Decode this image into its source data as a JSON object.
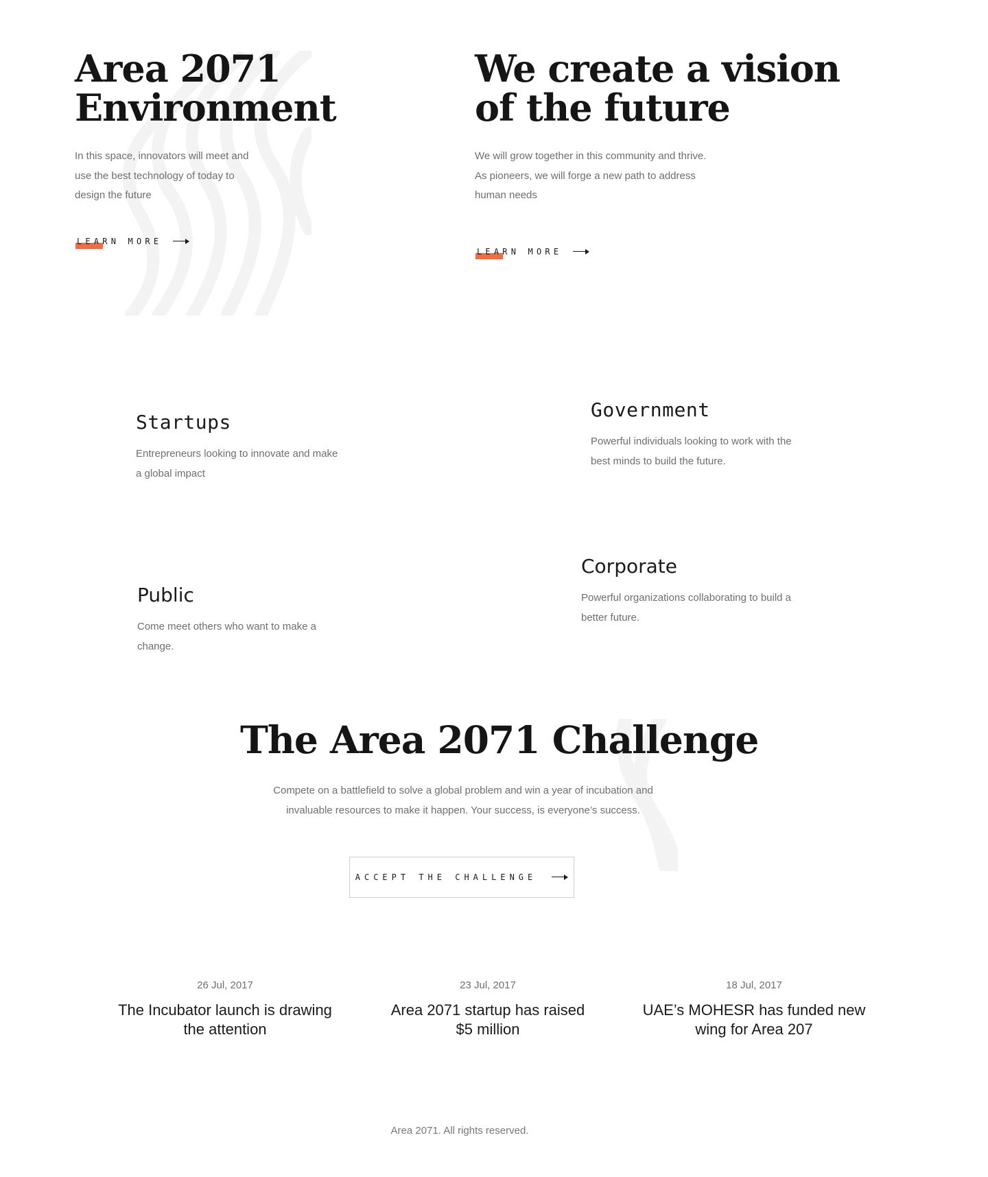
{
  "environment": {
    "title_line1": "Area 2071",
    "title_line2": "Environment",
    "body": "In this space, innovators will meet and\nuse the best technology of today to\ndesign the future",
    "link_label": "Learn more"
  },
  "vision": {
    "title_line1": "We create a vision",
    "title_line2": "of the future",
    "body": "We will grow together in this community and thrive.\nAs pioneers, we will forge a new path to address\nhuman needs",
    "link_label": "Learn more"
  },
  "audiences": {
    "startups": {
      "title": "Startups",
      "body": "Entrepreneurs looking to innovate and make\na global impact"
    },
    "government": {
      "title": "Government",
      "body": "Powerful individuals looking to work with the\nbest minds to build the future."
    },
    "public": {
      "title": "Public",
      "body": "Come meet others who want to make a\nchange."
    },
    "corporate": {
      "title": "Corporate",
      "body": "Powerful organizations collaborating to build a\nbetter future."
    }
  },
  "challenge": {
    "title": "The Area 2071 Challenge",
    "body": "Compete on a battlefield to solve a global problem and win a year of incubation and\ninvaluable resources to make it happen. Your success, is everyone’s success.",
    "cta_label": "Accept the challenge"
  },
  "news": [
    {
      "date": "26 Jul, 2017",
      "headline": "The Incubator launch is drawing\nthe attention"
    },
    {
      "date": "23 Jul, 2017",
      "headline": "Area 2071 startup has raised\n$5 million"
    },
    {
      "date": "18 Jul, 2017",
      "headline": "UAE’s MOHESR has funded new\nwing for Area 207"
    }
  ],
  "footer": {
    "copyright": "Area 2071. All rights reserved."
  },
  "colors": {
    "accent": "#f26c41",
    "text": "#1a1a1a",
    "muted": "#6e6e6e",
    "swirl": "#f5f5f5"
  },
  "icons": {
    "link_arrow": "arrow-right-icon",
    "cta_arrow": "arrow-right-icon"
  }
}
